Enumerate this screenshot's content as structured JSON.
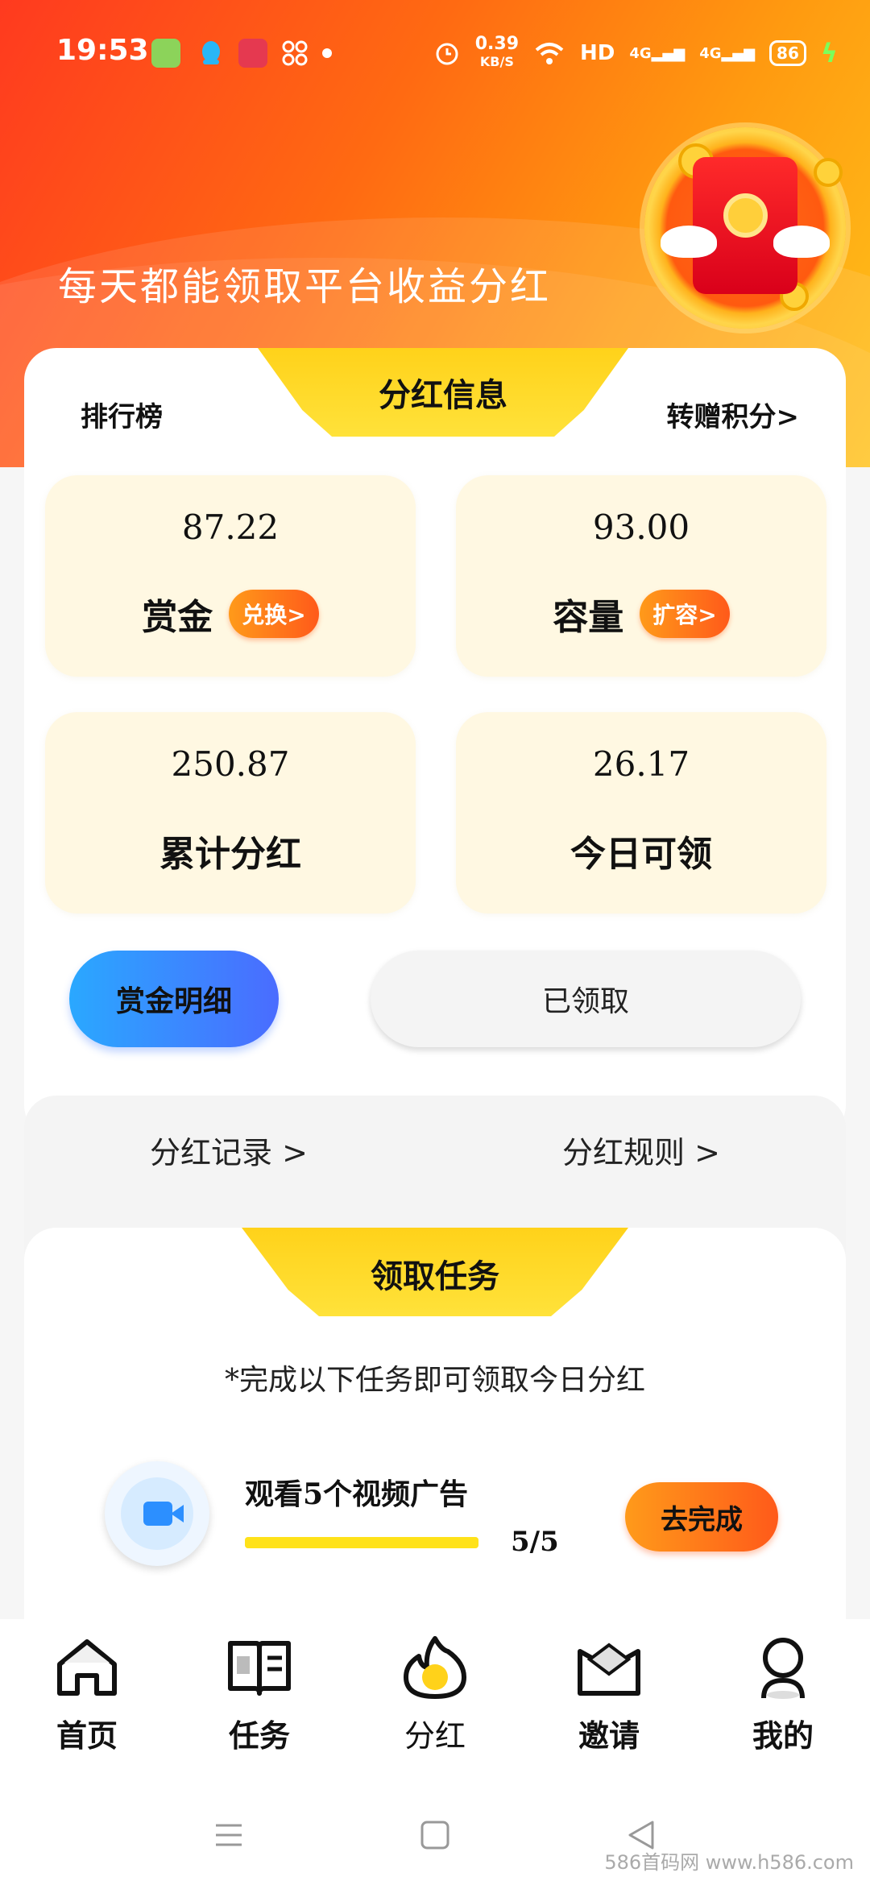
{
  "status_bar": {
    "time": "19:53",
    "net_speed": "0.39",
    "net_unit": "KB/S",
    "hd": "HD",
    "signal1": "4G",
    "signal2": "4G",
    "battery": "86"
  },
  "hero": {
    "title": "每天都能领取平台收益分红"
  },
  "info_card": {
    "title": "分红信息",
    "left_link": "排行榜",
    "right_link": "转赠积分>",
    "stats": [
      {
        "value": "87.22",
        "label": "赏金",
        "action": "兑换>"
      },
      {
        "value": "93.00",
        "label": "容量",
        "action": "扩容>"
      },
      {
        "value": "250.87",
        "label": "累计分红"
      },
      {
        "value": "26.17",
        "label": "今日可领"
      }
    ],
    "detail_button": "赏金明细",
    "claimed_button": "已领取"
  },
  "links": {
    "records": "分红记录  >",
    "rules": "分红规则  >"
  },
  "task_card": {
    "title": "领取任务",
    "hint": "*完成以下任务即可领取今日分红",
    "task": {
      "name": "观看5个视频广告",
      "progress_text": "5/5",
      "progress_fraction": 1.0,
      "button": "去完成"
    }
  },
  "nav": {
    "items": [
      {
        "label": "首页",
        "icon": "home-icon"
      },
      {
        "label": "任务",
        "icon": "book-icon"
      },
      {
        "label": "分红",
        "icon": "flame-icon"
      },
      {
        "label": "邀请",
        "icon": "envelope-icon"
      },
      {
        "label": "我的",
        "icon": "user-icon"
      }
    ]
  },
  "watermark": "586首码网 www.h586.com",
  "colors": {
    "accent_yellow": "#ffd21a",
    "orange": "#ff6a12",
    "blue": "#2aa8ff"
  }
}
